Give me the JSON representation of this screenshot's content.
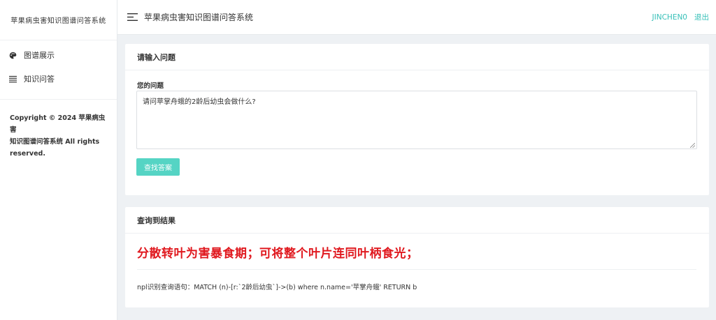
{
  "sidebar": {
    "brand": "苹果病虫害知识图谱问答系统",
    "items": [
      {
        "label": "图谱展示",
        "icon": "palette-icon"
      },
      {
        "label": "知识问答",
        "icon": "list-icon"
      }
    ],
    "copyright_line1": "Copyright © 2024 苹果病虫害",
    "copyright_line2": "知识图谱问答系统 All rights",
    "copyright_line3": "reserved."
  },
  "header": {
    "title": "苹果病虫害知识图谱问答系统",
    "user": "JINCHEN0",
    "logout": "退出"
  },
  "question_card": {
    "title": "请输入问题",
    "field_label": "您的问题",
    "question_value": "请问苹掌舟蛾的2龄后幼虫会做什么?",
    "submit_label": "查找答案"
  },
  "result_card": {
    "title": "查询到结果",
    "answer": "分散转叶为害暴食期；可将整个叶片连同叶柄食光；",
    "query_prefix": "npl识别查询语句：",
    "query": "MATCH (n)-[r:`2龄后幼虫`]->(b) where n.name='苹掌舟蛾' RETURN b"
  },
  "colors": {
    "accent": "#36c0b8",
    "button": "#55d4c4",
    "answer": "#e0191f"
  }
}
